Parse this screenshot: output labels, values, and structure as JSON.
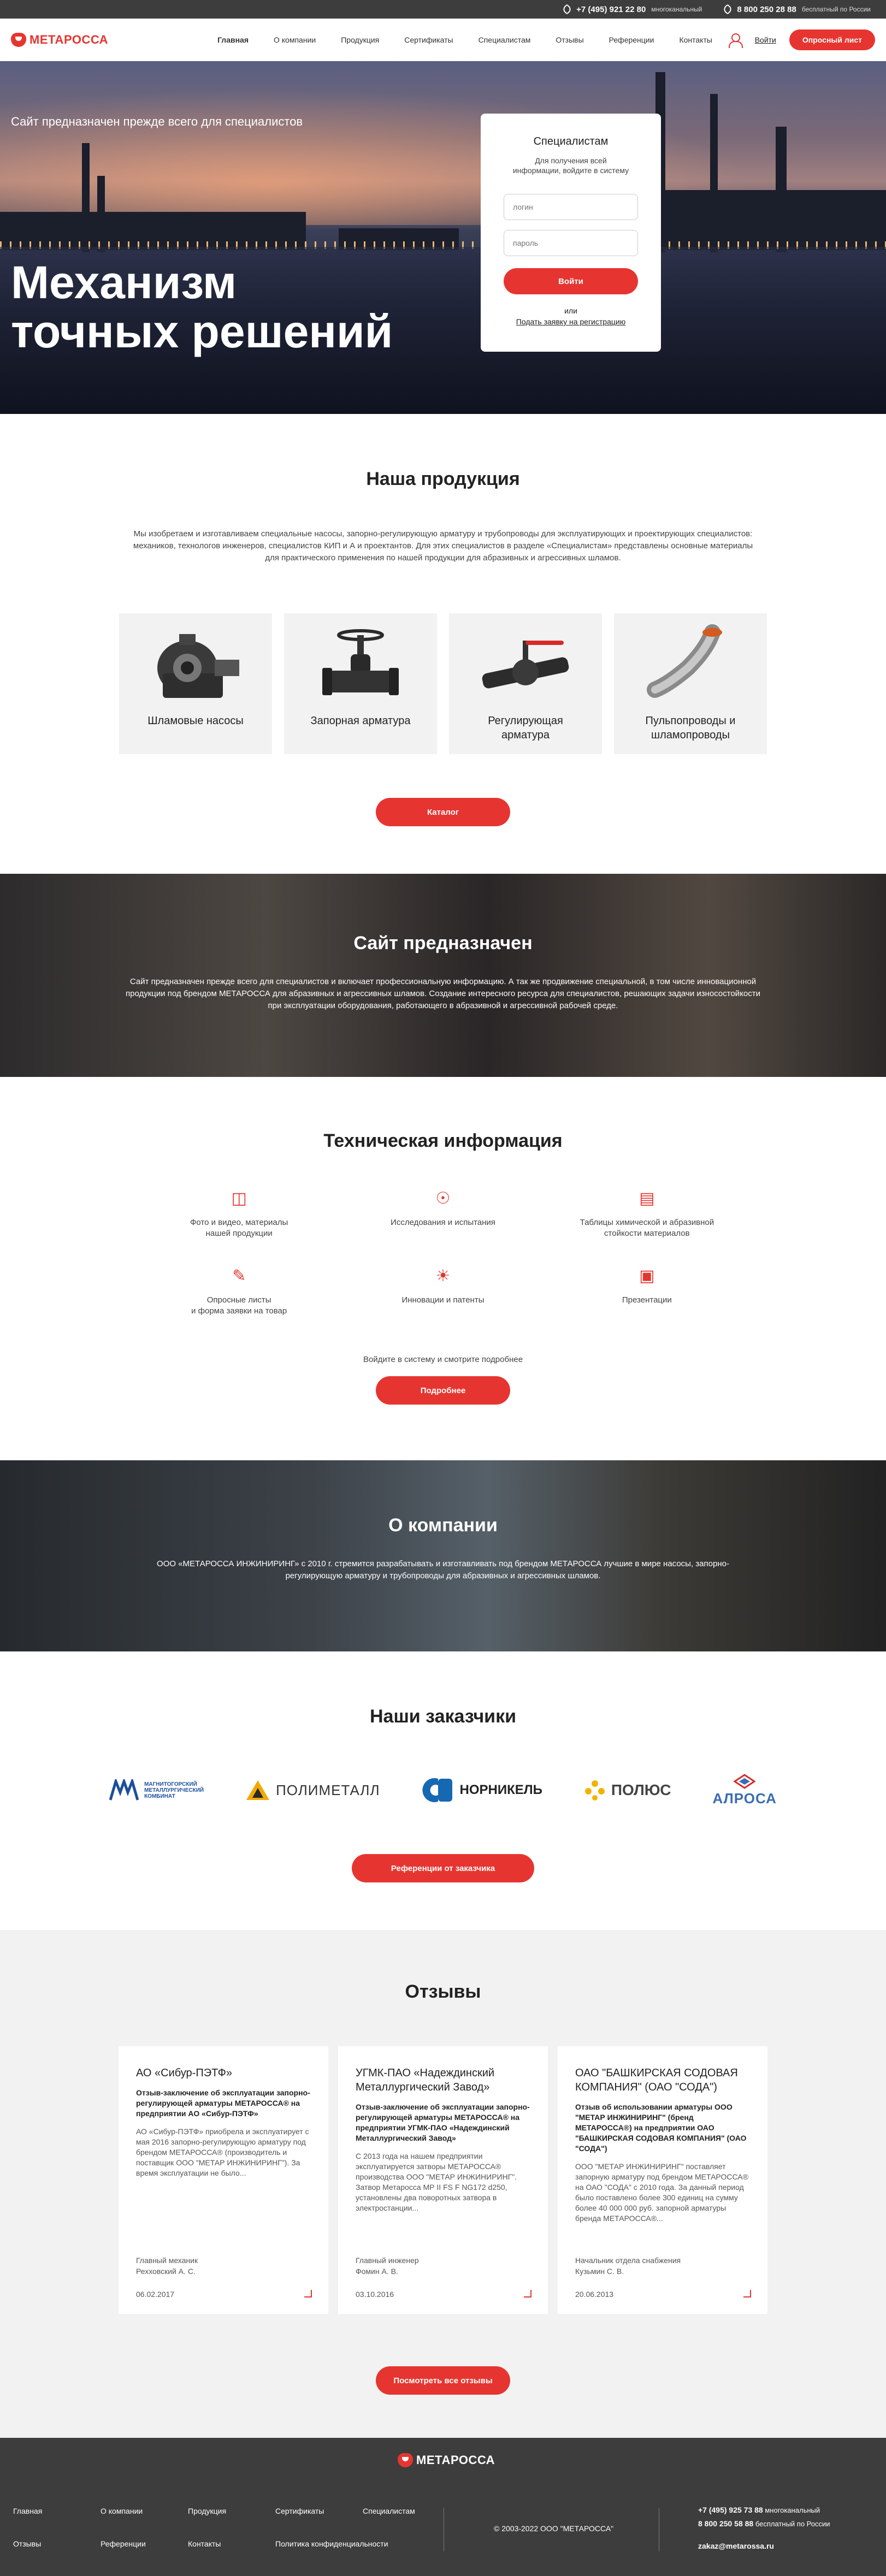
{
  "topbar": {
    "phone1": "+7 (495) 921 22 80",
    "phone1_note": "многоканальный",
    "phone2": "8 800 250 28 88",
    "phone2_note": "бесплатный по России"
  },
  "header": {
    "logo": "МЕТАРОССА",
    "nav": [
      "Главная",
      "О компании",
      "Продукция",
      "Сертификаты",
      "Специалистам",
      "Отзывы",
      "Референции",
      "Контакты"
    ],
    "login": "Войти",
    "cta": "Опросный лист"
  },
  "hero": {
    "tagline": "Сайт предназначен прежде всего для специалистов",
    "title_line1": "Механизм",
    "title_line2": "точных решений"
  },
  "login_box": {
    "title": "Специалистам",
    "subtitle_line1": "Для получения всей",
    "subtitle_line2": "информации, войдите в систему",
    "login_placeholder": "логин",
    "password_placeholder": "пароль",
    "submit": "Войти",
    "or": "или",
    "request": "Подать заявку на регистрацию"
  },
  "products": {
    "title": "Наша продукция",
    "lead": "Мы изобретаем и изготавливаем специальные насосы, запорно-регулирующую арматуру и трубопроводы для эксплуатирующих и проектирующих специалистов: механиков, технологов инженеров, специалистов КИП и А и проектантов. Для этих специалистов в разделе «Специалистам» представлены основные материалы для практического применения по нашей продукции для абразивных и агрессивных шламов.",
    "items": [
      {
        "line1": "Шламовые насосы",
        "line2": ""
      },
      {
        "line1": "Запорная арматура",
        "line2": ""
      },
      {
        "line1": "Регулирующая",
        "line2": "арматура"
      },
      {
        "line1": "Пульпопроводы и",
        "line2": "шламопроводы"
      }
    ],
    "button": "Каталог"
  },
  "purpose": {
    "title": "Сайт предназначен",
    "lead": "Сайт предназначен прежде всего для специалистов и включает профессиональную информацию. А так же продвижение специальной, в том числе инновационной продукции под брендом МЕТАРОССА для абразивных и агрессивных шламов. Создание интересного ресурса для специалистов, решающих задачи износостойкости при эксплуатации оборудования, работающего в абразивной и агрессивной рабочей среде."
  },
  "tech": {
    "title": "Техническая информация",
    "items": [
      {
        "icon": "photo-video-icon",
        "line1": "Фото и видео, материалы",
        "line2": "нашей продукции"
      },
      {
        "icon": "research-icon",
        "line1": "Исследования и испытания",
        "line2": ""
      },
      {
        "icon": "tables-icon",
        "line1": "Таблицы химической и абразивной",
        "line2": "стойкости материалов"
      },
      {
        "icon": "questionnaire-icon",
        "line1": "Опросные листы",
        "line2": "и форма заявки на товар"
      },
      {
        "icon": "innovation-icon",
        "line1": "Инновации и патенты",
        "line2": ""
      },
      {
        "icon": "presentation-icon",
        "line1": "Презентации",
        "line2": ""
      }
    ],
    "note": "Войдите в систему и смотрите подробнее",
    "button": "Подробнее"
  },
  "about": {
    "title": "О компании",
    "lead": "ООО «МЕТАРОССА ИНЖИНИРИНГ» с 2010 г. стремится разрабатывать и изготавливать под брендом МЕТАРОССА лучшие в мире насосы, запорно-регулирующую арматуру и трубопроводы для абразивных и агрессивных шламов."
  },
  "clients": {
    "title": "Наши заказчики",
    "logos": [
      {
        "line1": "МАГНИТОГОРСКИЙ",
        "line2": "МЕТАЛЛУРГИЧЕСКИЙ",
        "line3": "КОМБИНАТ"
      },
      {
        "name": "ПОЛИМЕТАЛЛ"
      },
      {
        "name": "НОРНИКЕЛЬ"
      },
      {
        "name": "ПОЛЮС"
      },
      {
        "name": "АЛРОСА"
      }
    ],
    "button": "Референции от заказчика"
  },
  "reviews": {
    "title": "Отзывы",
    "items": [
      {
        "company": "АО «Сибур-ПЭТФ»",
        "subject": "Отзыв-заключение об эксплуатации запорно-регулирующей арматуры МЕТАРОССА® на предприятии АО «Сибур-ПЭТФ»",
        "text": "АО «Сибур-ПЭТФ» приобрела и эксплуатирует с мая 2016 запорно-регулирующую арматуру под брендом МЕТАРОССА® (производитель и поставщик ООО \"МЕТАР ИНЖИНИРИНГ\"). За время эксплуатации не было...",
        "role": "Главный механик",
        "person": "Рехховский А. С.",
        "date": "06.02.2017"
      },
      {
        "company": "УГМК-ПАО «Надеждинский Металлургический Завод»",
        "subject": "Отзыв-заключение об эксплуатации запорно-регулирующей арматуры МЕТАРОССА® на предприятии УГМК-ПАО «Надеждинский Металлургический Завод»",
        "text": "С 2013 года на нашем предприятии эксплуатируется затворы МЕТАРОССА® производства ООО \"МЕТАР ИНЖИНИРИНГ\". Затвор Метаросса МР II FS F NG172 d250, установлены два поворотных затвора в электростанции...",
        "role": "Главный инженер",
        "person": "Фомин А. В.",
        "date": "03.10.2016"
      },
      {
        "company": "ОАО \"БАШКИРСКАЯ СОДОВАЯ КОМПАНИЯ\" (ОАО \"СОДА\")",
        "subject": "Отзыв об использовании арматуры ООО \"МЕТАР ИНЖИНИРИНГ\" (бренд МЕТАРОССА®) на предприятии ОАО \"БАШКИРСКАЯ СОДОВАЯ КОМПАНИЯ\" (ОАО \"СОДА\")",
        "text": "ООО \"МЕТАР ИНЖИНИРИНГ\" поставляет запорную арматуру под брендом МЕТАРОССА® на ОАО \"СОДА\" с 2010 года. За данный период было поставлено более 300 единиц на сумму более 40 000 000 руб. запорной арматуры бренда МЕТАРОССА®...",
        "role": "Начальник отдела снабжения",
        "person": "Кузьмин С. В.",
        "date": "20.06.2013"
      }
    ],
    "button": "Посмотреть все отзывы"
  },
  "footer": {
    "logo": "МЕТАРОССА",
    "nav": [
      "Главная",
      "О компании",
      "Продукция",
      "Сертификаты",
      "Специалистам",
      "Отзывы",
      "Референции",
      "Контакты",
      "Политика конфиденциальности"
    ],
    "copyright": "© 2003-2022 ООО \"МЕТАРОССА\"",
    "phone1": "+7 (495) 925 73 88",
    "phone1_note": "многоканальный",
    "phone2": "8 800 250 58 88",
    "phone2_note": "бесплатный по России",
    "email": "zakaz@metarossa.ru"
  },
  "colors": {
    "accent": "#e63530",
    "dark": "#3d3d3d",
    "light": "#f2f2f2"
  }
}
